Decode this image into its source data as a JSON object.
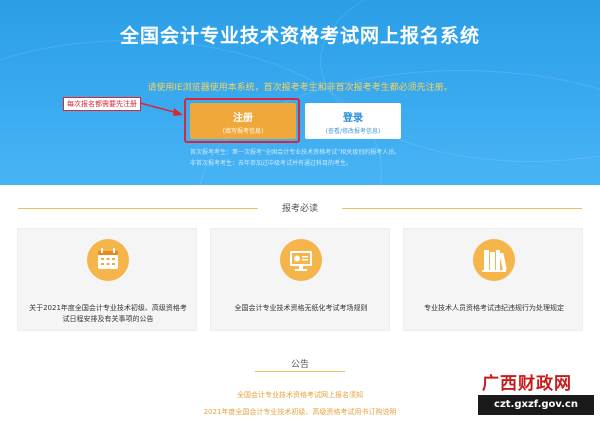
{
  "header": {
    "title": "全国会计专业技术资格考试网上报名系统",
    "notice": "请使用IE浏览器使用本系统，首次报考考生和非首次报考考生都必须先注册。"
  },
  "actions": {
    "register_label": "注册",
    "register_sub": "(填写报考信息)",
    "login_label": "登录",
    "login_sub": "(查看/修改报考信息)"
  },
  "annotation": "每次报名都需要先注册",
  "hints": [
    "首次报考考生：第一次报考“全国会计专业技术资格考试”相关级别的报考人员。",
    "非首次报考考生：去年参加过中级考试并有通过科目的考生。"
  ],
  "section_title": "报考必读",
  "cards": [
    {
      "icon": "calendar-icon",
      "text": "关于2021年度全国会计专业技术初级、高级资格考试日程安排及有关事项的公告"
    },
    {
      "icon": "computer-screen-icon",
      "text": "全国会计专业技术资格无纸化考试考场规则"
    },
    {
      "icon": "books-icon",
      "text": "专业技术人员资格考试违纪违规行为处理规定"
    }
  ],
  "announcement_title": "公告",
  "announcements": [
    "全国会计专业技术资格考试网上报名须知",
    "2021年度全国会计专业技术初级、高级资格考试用书订购说明"
  ],
  "watermark": {
    "brand": "广西财政网",
    "url": "czt.gxzf.gov.cn"
  },
  "colors": {
    "hero_blue": "#2a9ee6",
    "accent_orange": "#f0a83a",
    "highlight_red": "#d6283a",
    "link_gold": "#e6a23c"
  }
}
